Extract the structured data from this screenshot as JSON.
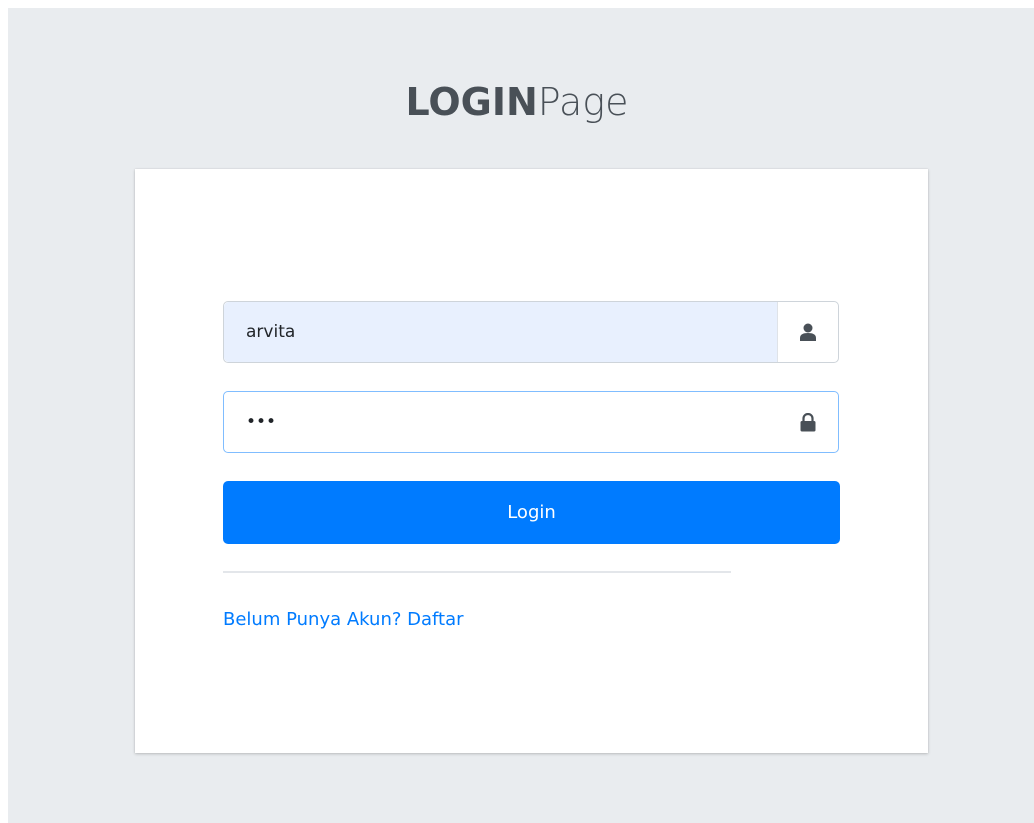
{
  "logo": {
    "bold": "LOGIN",
    "light": "Page"
  },
  "form": {
    "username_value": "arvita",
    "password_value": "•••",
    "login_label": "Login"
  },
  "links": {
    "register": "Belum Punya Akun? Daftar"
  },
  "icons": {
    "username": "user-icon",
    "password": "lock-icon"
  },
  "colors": {
    "background": "#e9ecef",
    "card": "#ffffff",
    "primary": "#007bff",
    "autofill": "#e8f0fe",
    "text": "#495057"
  }
}
